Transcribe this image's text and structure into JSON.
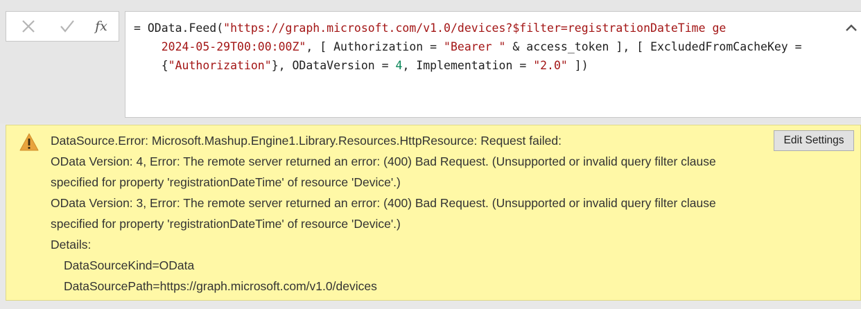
{
  "formula_bar": {
    "cancel_icon": "x-icon",
    "commit_icon": "check-icon",
    "insert_function_label": "fx",
    "code_lines": [
      [
        {
          "t": "= OData.Feed(",
          "c": ""
        },
        {
          "t": "\"https://graph.microsoft.com/v1.0/devices?$filter=registrationDateTime ge",
          "c": "str"
        }
      ],
      [
        {
          "t": "    2024-05-29T00:00:00Z\"",
          "c": "str"
        },
        {
          "t": ", [ Authorization = ",
          "c": ""
        },
        {
          "t": "\"Bearer \"",
          "c": "str"
        },
        {
          "t": " & access_token ], [ ExcludedFromCacheKey =",
          "c": ""
        }
      ],
      [
        {
          "t": "    {",
          "c": ""
        },
        {
          "t": "\"Authorization\"",
          "c": "str"
        },
        {
          "t": "}, ODataVersion = ",
          "c": ""
        },
        {
          "t": "4",
          "c": "num"
        },
        {
          "t": ", Implementation = ",
          "c": ""
        },
        {
          "t": "\"2.0\"",
          "c": "str"
        },
        {
          "t": " ])",
          "c": ""
        }
      ]
    ],
    "collapse_icon": "chevron-up-icon"
  },
  "error": {
    "icon": "warning-icon",
    "lines": [
      "DataSource.Error: Microsoft.Mashup.Engine1.Library.Resources.HttpResource: Request failed:",
      "OData Version: 4, Error: The remote server returned an error: (400) Bad Request. (Unsupported or invalid query filter clause",
      "specified for property 'registrationDateTime' of resource 'Device'.)",
      "OData Version: 3, Error: The remote server returned an error: (400) Bad Request. (Unsupported or invalid query filter clause",
      "specified for property 'registrationDateTime' of resource 'Device'.)",
      "Details:"
    ],
    "details": [
      "DataSourceKind=OData",
      "DataSourcePath=https://graph.microsoft.com/v1.0/devices"
    ],
    "edit_settings_label": "Edit Settings"
  },
  "colors": {
    "banner_bg": "#fff8a6",
    "string": "#a31515",
    "number": "#098658",
    "warning": "#e8a33d"
  }
}
